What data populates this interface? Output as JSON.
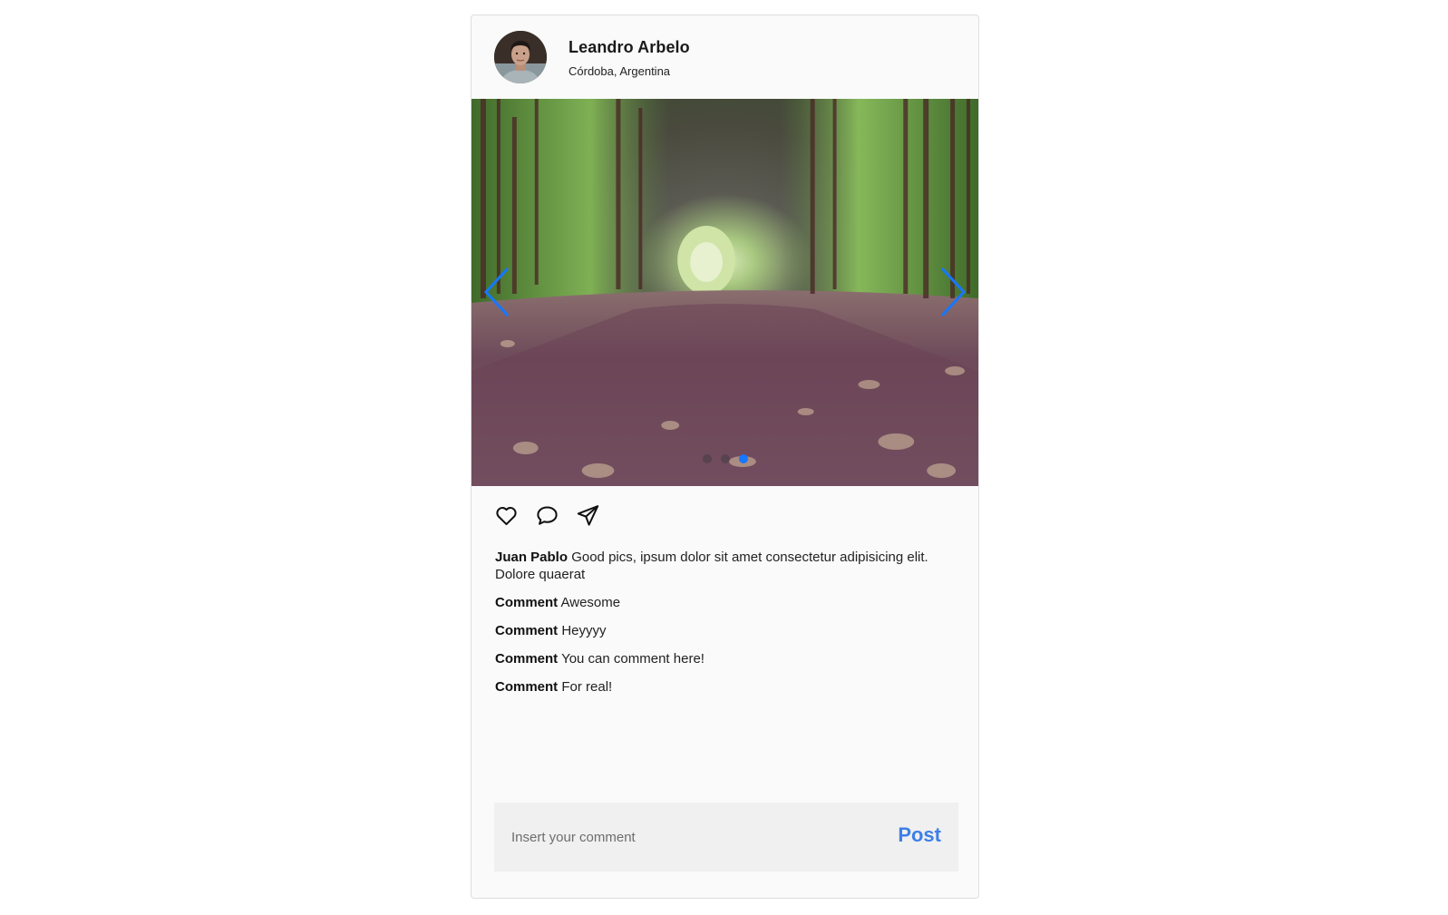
{
  "post": {
    "author": {
      "name": "Leandro Arbelo",
      "location": "Córdoba, Argentina"
    },
    "carousel": {
      "slide_count": 3,
      "active_slide": 3,
      "accent_color": "#1677ff"
    },
    "actions": [
      "heart-icon",
      "comment-icon",
      "share-icon"
    ],
    "caption": {
      "author": "Juan Pablo",
      "text": "Good pics, ipsum dolor sit amet consectetur adipisicing elit. Dolore quaerat"
    },
    "comments": [
      {
        "author": "Comment",
        "text": "Awesome"
      },
      {
        "author": "Comment",
        "text": "Heyyyy"
      },
      {
        "author": "Comment",
        "text": "You can comment here!"
      },
      {
        "author": "Comment",
        "text": "For real!"
      }
    ],
    "comment_form": {
      "placeholder": "Insert your comment",
      "value": "",
      "post_label": "Post",
      "post_color": "#3d7fe6"
    }
  }
}
